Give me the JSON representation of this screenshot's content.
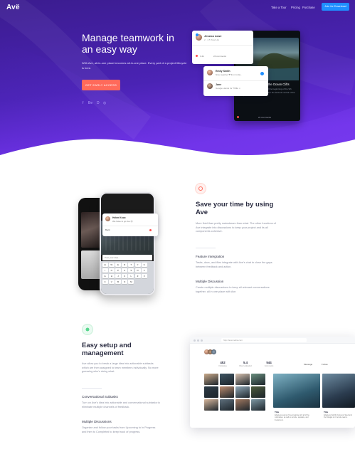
{
  "brand": {
    "logo": "Avë"
  },
  "nav": {
    "items": [
      "Take a Tour",
      "Pricing",
      "Purchase"
    ],
    "cta": "Join for Download"
  },
  "hero": {
    "title": "Manage teamwork in an easy way",
    "subtitle": "With Ave, all-in-one place becomes all-in-one place. Every part of a project lifecycle is here.",
    "button": "GET EARLY ACCESS",
    "social": [
      "f",
      "Be",
      "D",
      "◎"
    ]
  },
  "hero_cards": {
    "profile": {
      "name": "Jessica Lowe",
      "meta": "2 · 4.5 Total Hrs",
      "likes": "3.4k",
      "comments": "24 comments"
    },
    "comments": [
      {
        "name": "Emily Smith",
        "text": "Nice weather ❤ from India.."
      },
      {
        "name": "Jane",
        "text": "Google Hands for TIME ☺"
      }
    ],
    "dark_card": {
      "name": "Ian Johnson",
      "title": "In the past 2,500 years the Ocean Clifts",
      "body": "Sorted by the sea, which reached the beginning of the 9th century BC. Romo usually fell under the ancient control of the Keotoc, which then settled in.",
      "footer": "24 comments"
    }
  },
  "section1": {
    "title": "Save your time by using Ave",
    "body": "More fluid than pretty mainstream than what. The other functions of Ave integrate into discussions to keep your project and its all components cohesive.",
    "features": [
      {
        "title": "Feature Intergration",
        "body": "Tasks, docs, and files integrate with Ave's chat to close the gaps between feedback and action."
      },
      {
        "title": "Multiple Discussion",
        "body": "Create multiple discussions to keep all relevant conversations together, all in one place with Ave."
      }
    ],
    "phone": {
      "post_name": "Helen Knox",
      "post_text": "We have to go live 😊",
      "input": "Post your idea...",
      "back": "Back",
      "keys": [
        "Q",
        "W",
        "E",
        "R",
        "T",
        "Y",
        "U",
        "I",
        "O",
        "P",
        "A",
        "S",
        "D",
        "F",
        "G",
        "H",
        "J",
        "K",
        "L",
        "Z",
        "X",
        "C",
        "V",
        "B",
        "N",
        "M"
      ]
    }
  },
  "section2": {
    "title": "Easy setup and management",
    "body": "Ave allow you to break a large idea into actionable subtasks which are then assigned to team members individually. No more guessing who's doing what.",
    "features": [
      {
        "title": "Conversational Subtasks",
        "body": "Turn on Ave's idea into actionable and conversational subtasks to eliminate multiple channels of feedback."
      },
      {
        "title": "Multiple Discussions",
        "body": "Organize and follow your tasks from Upcoming to In Progress and then to Completed to keep track of progress."
      }
    ],
    "browser": {
      "url": "http://avemedia.com",
      "stats": [
        {
          "value": "452",
          "label": "Following"
        },
        {
          "value": "5.4",
          "label": "Files Uploaded"
        },
        {
          "value": "544",
          "label": "Comments"
        }
      ],
      "tabs": [
        "Message",
        "Follow"
      ],
      "captions": [
        {
          "title": "Title",
          "body": "Edgeless teams of Ave integrate with all of the companies, as well as remote, separate, and freelancers."
        },
        {
          "title": "Title",
          "body": "Edgeless Faithful Cameron Sped and the Dolegat on it remote teams."
        }
      ]
    }
  },
  "colors": {
    "hero_top": "#3a1a8a",
    "hero_bottom": "#6a2be0",
    "cta_blue": "#1f8fff",
    "coral": "#ff6a5b",
    "mint": "#57d68d"
  }
}
